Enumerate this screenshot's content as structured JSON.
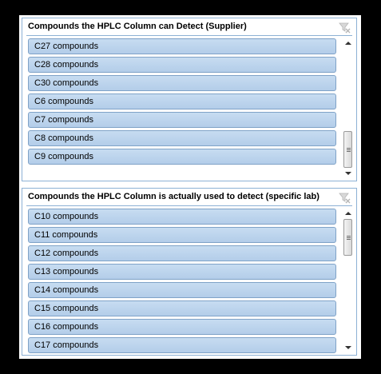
{
  "slicers": [
    {
      "title": "Compounds the HPLC Column can Detect (Supplier)",
      "items": [
        {
          "label": "C27 compounds"
        },
        {
          "label": "C28 compounds"
        },
        {
          "label": "C30 compounds"
        },
        {
          "label": "C6 compounds"
        },
        {
          "label": "C7 compounds"
        },
        {
          "label": "C8 compounds"
        },
        {
          "label": "C9 compounds"
        }
      ],
      "scroll_position": 1.0
    },
    {
      "title": "Compounds the HPLC Column is actually used to detect (specific lab)",
      "items": [
        {
          "label": "C10 compounds"
        },
        {
          "label": "C11 compounds"
        },
        {
          "label": "C12 compounds"
        },
        {
          "label": "C13 compounds"
        },
        {
          "label": "C14 compounds"
        },
        {
          "label": "C15 compounds"
        },
        {
          "label": "C16 compounds"
        },
        {
          "label": "C17 compounds"
        }
      ],
      "scroll_position": 0.0
    }
  ],
  "icons": {
    "clear_filter": "clear-filter-icon",
    "scroll_up": "scroll-up-arrow-icon",
    "scroll_down": "scroll-down-arrow-icon"
  },
  "colors": {
    "background": "#000000",
    "panel": "#ffffff",
    "slicer_border": "#8db1d5",
    "item_fill": "#b8d2ec",
    "item_border": "#7fa2c7"
  }
}
